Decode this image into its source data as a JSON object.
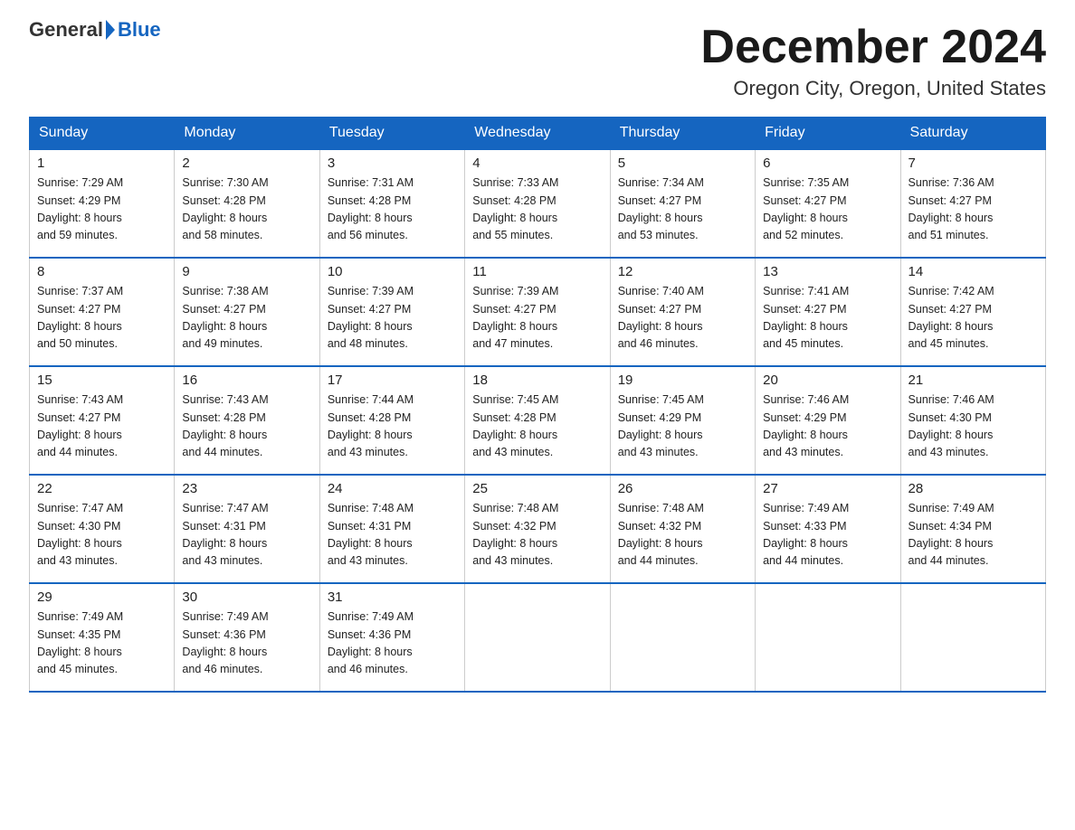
{
  "header": {
    "logo_general": "General",
    "logo_blue": "Blue",
    "month_title": "December 2024",
    "location": "Oregon City, Oregon, United States"
  },
  "days_of_week": [
    "Sunday",
    "Monday",
    "Tuesday",
    "Wednesday",
    "Thursday",
    "Friday",
    "Saturday"
  ],
  "weeks": [
    [
      {
        "day": "1",
        "sunrise": "7:29 AM",
        "sunset": "4:29 PM",
        "daylight": "8 hours and 59 minutes."
      },
      {
        "day": "2",
        "sunrise": "7:30 AM",
        "sunset": "4:28 PM",
        "daylight": "8 hours and 58 minutes."
      },
      {
        "day": "3",
        "sunrise": "7:31 AM",
        "sunset": "4:28 PM",
        "daylight": "8 hours and 56 minutes."
      },
      {
        "day": "4",
        "sunrise": "7:33 AM",
        "sunset": "4:28 PM",
        "daylight": "8 hours and 55 minutes."
      },
      {
        "day": "5",
        "sunrise": "7:34 AM",
        "sunset": "4:27 PM",
        "daylight": "8 hours and 53 minutes."
      },
      {
        "day": "6",
        "sunrise": "7:35 AM",
        "sunset": "4:27 PM",
        "daylight": "8 hours and 52 minutes."
      },
      {
        "day": "7",
        "sunrise": "7:36 AM",
        "sunset": "4:27 PM",
        "daylight": "8 hours and 51 minutes."
      }
    ],
    [
      {
        "day": "8",
        "sunrise": "7:37 AM",
        "sunset": "4:27 PM",
        "daylight": "8 hours and 50 minutes."
      },
      {
        "day": "9",
        "sunrise": "7:38 AM",
        "sunset": "4:27 PM",
        "daylight": "8 hours and 49 minutes."
      },
      {
        "day": "10",
        "sunrise": "7:39 AM",
        "sunset": "4:27 PM",
        "daylight": "8 hours and 48 minutes."
      },
      {
        "day": "11",
        "sunrise": "7:39 AM",
        "sunset": "4:27 PM",
        "daylight": "8 hours and 47 minutes."
      },
      {
        "day": "12",
        "sunrise": "7:40 AM",
        "sunset": "4:27 PM",
        "daylight": "8 hours and 46 minutes."
      },
      {
        "day": "13",
        "sunrise": "7:41 AM",
        "sunset": "4:27 PM",
        "daylight": "8 hours and 45 minutes."
      },
      {
        "day": "14",
        "sunrise": "7:42 AM",
        "sunset": "4:27 PM",
        "daylight": "8 hours and 45 minutes."
      }
    ],
    [
      {
        "day": "15",
        "sunrise": "7:43 AM",
        "sunset": "4:27 PM",
        "daylight": "8 hours and 44 minutes."
      },
      {
        "day": "16",
        "sunrise": "7:43 AM",
        "sunset": "4:28 PM",
        "daylight": "8 hours and 44 minutes."
      },
      {
        "day": "17",
        "sunrise": "7:44 AM",
        "sunset": "4:28 PM",
        "daylight": "8 hours and 43 minutes."
      },
      {
        "day": "18",
        "sunrise": "7:45 AM",
        "sunset": "4:28 PM",
        "daylight": "8 hours and 43 minutes."
      },
      {
        "day": "19",
        "sunrise": "7:45 AM",
        "sunset": "4:29 PM",
        "daylight": "8 hours and 43 minutes."
      },
      {
        "day": "20",
        "sunrise": "7:46 AM",
        "sunset": "4:29 PM",
        "daylight": "8 hours and 43 minutes."
      },
      {
        "day": "21",
        "sunrise": "7:46 AM",
        "sunset": "4:30 PM",
        "daylight": "8 hours and 43 minutes."
      }
    ],
    [
      {
        "day": "22",
        "sunrise": "7:47 AM",
        "sunset": "4:30 PM",
        "daylight": "8 hours and 43 minutes."
      },
      {
        "day": "23",
        "sunrise": "7:47 AM",
        "sunset": "4:31 PM",
        "daylight": "8 hours and 43 minutes."
      },
      {
        "day": "24",
        "sunrise": "7:48 AM",
        "sunset": "4:31 PM",
        "daylight": "8 hours and 43 minutes."
      },
      {
        "day": "25",
        "sunrise": "7:48 AM",
        "sunset": "4:32 PM",
        "daylight": "8 hours and 43 minutes."
      },
      {
        "day": "26",
        "sunrise": "7:48 AM",
        "sunset": "4:32 PM",
        "daylight": "8 hours and 44 minutes."
      },
      {
        "day": "27",
        "sunrise": "7:49 AM",
        "sunset": "4:33 PM",
        "daylight": "8 hours and 44 minutes."
      },
      {
        "day": "28",
        "sunrise": "7:49 AM",
        "sunset": "4:34 PM",
        "daylight": "8 hours and 44 minutes."
      }
    ],
    [
      {
        "day": "29",
        "sunrise": "7:49 AM",
        "sunset": "4:35 PM",
        "daylight": "8 hours and 45 minutes."
      },
      {
        "day": "30",
        "sunrise": "7:49 AM",
        "sunset": "4:36 PM",
        "daylight": "8 hours and 46 minutes."
      },
      {
        "day": "31",
        "sunrise": "7:49 AM",
        "sunset": "4:36 PM",
        "daylight": "8 hours and 46 minutes."
      },
      null,
      null,
      null,
      null
    ]
  ],
  "labels": {
    "sunrise": "Sunrise:",
    "sunset": "Sunset:",
    "daylight": "Daylight:"
  }
}
